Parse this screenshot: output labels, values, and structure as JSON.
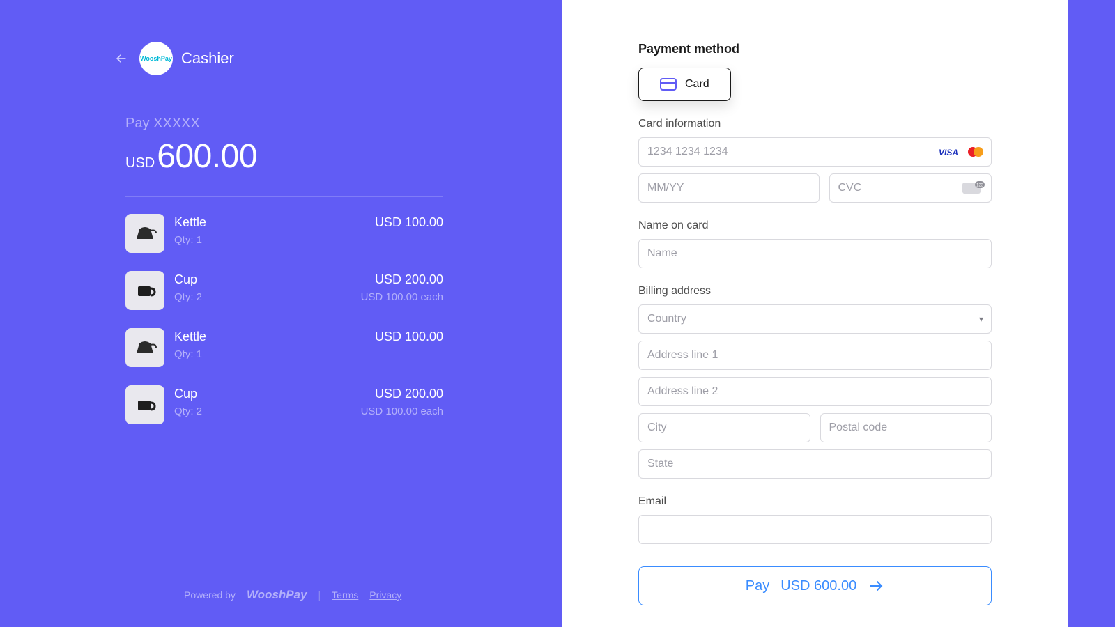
{
  "left": {
    "brand_name": "Cashier",
    "logo_text": "WooshPay",
    "pay_label": "Pay XXXXX",
    "currency": "USD",
    "amount": "600.00",
    "items": [
      {
        "name": "Kettle",
        "qty": "Qty: 1",
        "price": "USD 100.00",
        "each": "",
        "icon": "kettle"
      },
      {
        "name": "Cup",
        "qty": "Qty: 2",
        "price": "USD 200.00",
        "each": "USD 100.00 each",
        "icon": "cup"
      },
      {
        "name": "Kettle",
        "qty": "Qty: 1",
        "price": "USD 100.00",
        "each": "",
        "icon": "kettle"
      },
      {
        "name": "Cup",
        "qty": "Qty: 2",
        "price": "USD 200.00",
        "each": "USD 100.00 each",
        "icon": "cup"
      }
    ],
    "powered_by": "Powered by",
    "powered_brand": "WooshPay",
    "terms": "Terms",
    "privacy": "Privacy"
  },
  "right": {
    "heading": "Payment method",
    "method_label": "Card",
    "card_info_label": "Card information",
    "card_placeholder": "1234 1234 1234",
    "expiry_placeholder": "MM/YY",
    "cvc_placeholder": "CVC",
    "name_label": "Name on card",
    "name_placeholder": "Name",
    "billing_label": "Billing address",
    "country_placeholder": "Country",
    "addr1_placeholder": "Address line 1",
    "addr2_placeholder": "Address line 2",
    "city_placeholder": "City",
    "postal_placeholder": "Postal code",
    "state_placeholder": "State",
    "email_label": "Email",
    "pay_button_prefix": "Pay",
    "pay_button_amount": "USD 600.00",
    "brand_icons": {
      "visa": "VISA",
      "mastercard": "mastercard"
    }
  }
}
